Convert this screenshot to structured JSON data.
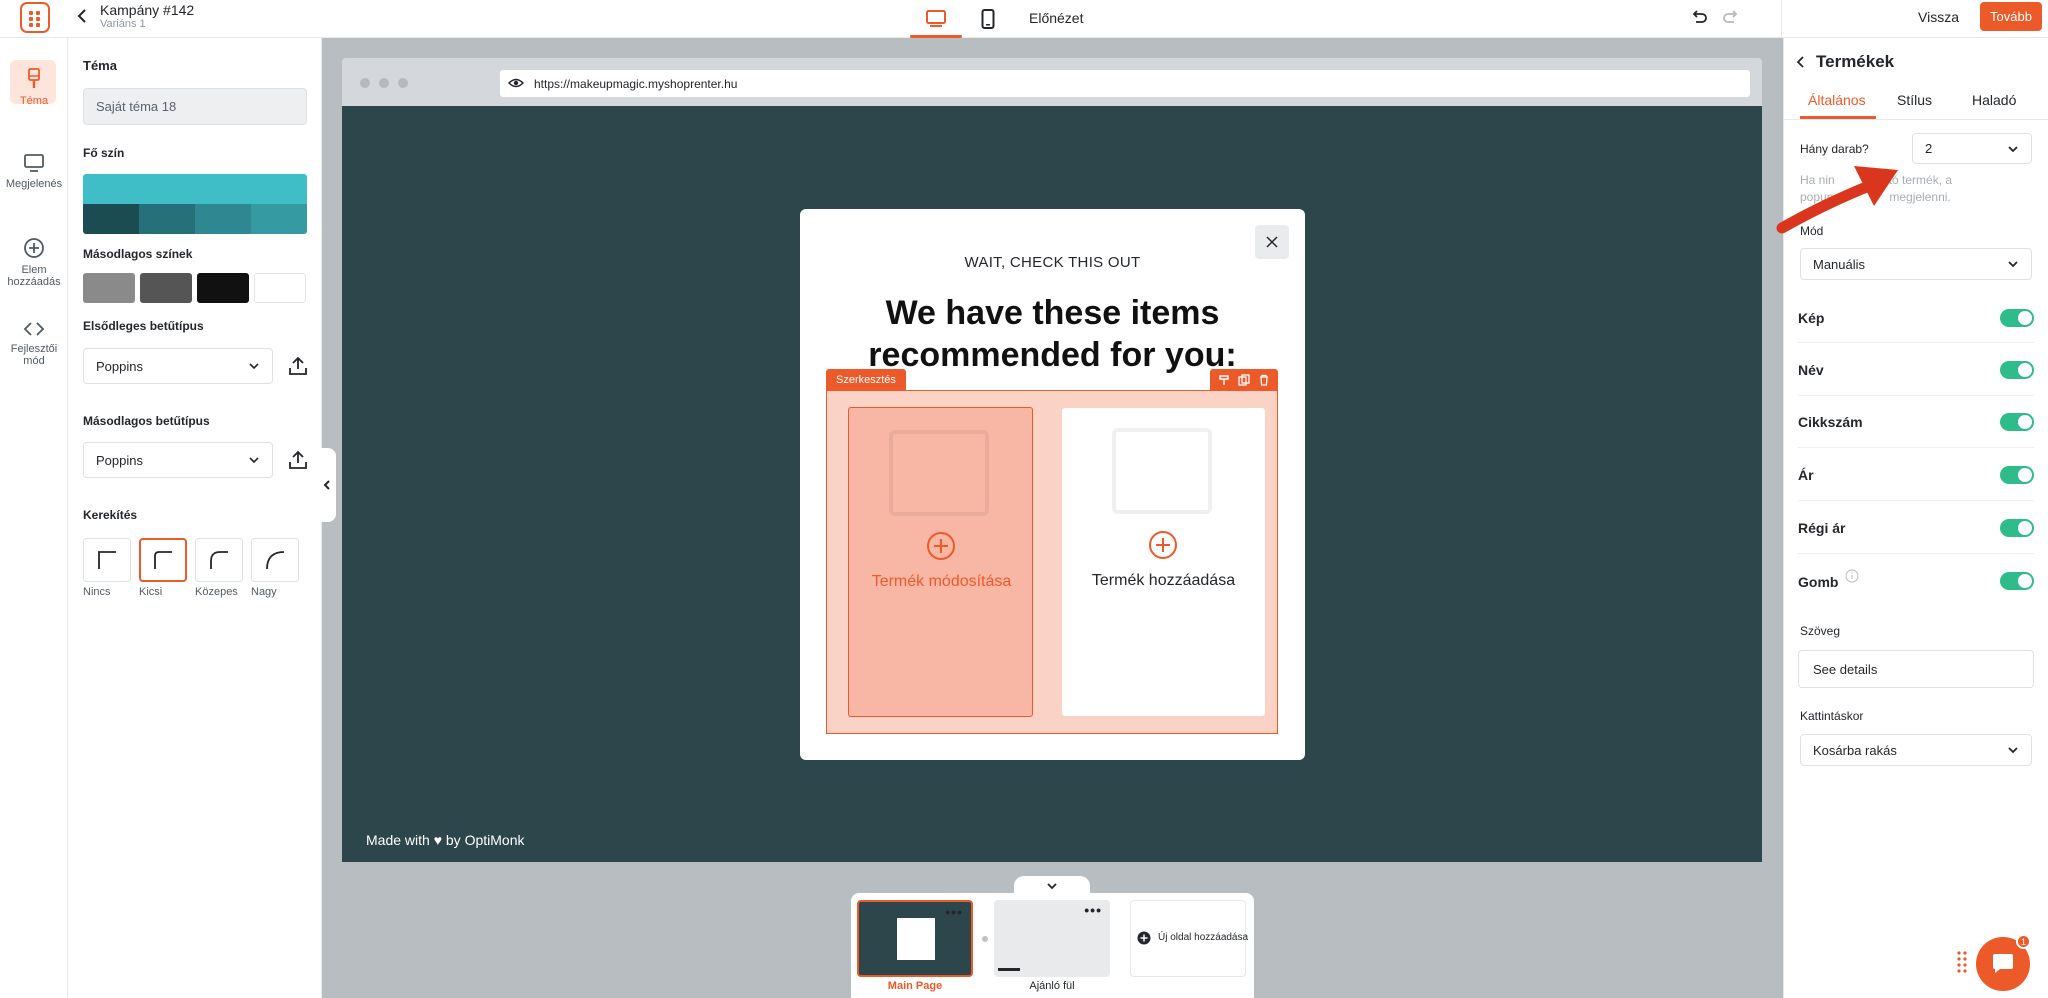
{
  "header": {
    "campaign_title": "Kampány #142",
    "variant": "Variáns 1",
    "preview_label": "Előnézet",
    "back_label": "Vissza",
    "next_label": "Tovább"
  },
  "rail": {
    "items": [
      {
        "label": "Téma",
        "icon": "brush-icon",
        "active": true
      },
      {
        "label": "Megjelenés",
        "icon": "monitor-icon",
        "active": false
      },
      {
        "label": "Elem hozzáadás",
        "icon": "plus-circle-icon",
        "active": false
      },
      {
        "label": "Fejlesztői mód",
        "icon": "code-icon",
        "active": false
      }
    ]
  },
  "theme_panel": {
    "title": "Téma",
    "theme_value": "Saját téma 18",
    "main_color_label": "Fő szín",
    "main_color": "#40bec8",
    "main_color_shades": [
      "#1b4c51",
      "#26707a",
      "#2f8891",
      "#369aa3"
    ],
    "secondary_colors_label": "Másodlagos színek",
    "secondary_colors": [
      "#8a8a8a",
      "#555555",
      "#111111",
      "#ffffff"
    ],
    "primary_font_label": "Elsődleges betűtípus",
    "primary_font_value": "Poppins",
    "secondary_font_label": "Másodlagos betűtípus",
    "secondary_font_value": "Poppins",
    "rounding_label": "Kerekítés",
    "rounding_options": [
      "Nincs",
      "Kicsi",
      "Közepes",
      "Nagy"
    ],
    "rounding_selected": "Kicsi"
  },
  "canvas": {
    "url": "https://makeupmagic.myshoprenter.hu",
    "made_with": "Made with ♥ by OptiMonk",
    "popup": {
      "eyebrow": "WAIT, CHECK THIS OUT",
      "heading": "We have these items recommended for you:",
      "edit_tag": "Szerkesztés",
      "card1_label": "Termék módosítása",
      "card2_label": "Termék hozzáadása"
    }
  },
  "pages": {
    "items": [
      "Main Page",
      "Ajánló fül"
    ],
    "active": "Main Page",
    "new_page_label": "Új oldal hozzáadása"
  },
  "right_panel": {
    "title": "Termékek",
    "tabs": [
      "Általános",
      "Stílus",
      "Haladó"
    ],
    "active_tab": "Általános",
    "count_label": "Hány darab?",
    "count_value": "2",
    "hint_visible": "Ha nin        lható termék, a popup            megjeleni.",
    "hint_line1": "Ha nin",
    "hint_line1b": "lható termék, a",
    "hint_line2": "popup",
    "hint_line2b": "megjelenni.",
    "mode_label": "Mód",
    "mode_value": "Manuális",
    "toggles": [
      {
        "label": "Kép",
        "on": true
      },
      {
        "label": "Név",
        "on": true
      },
      {
        "label": "Cikkszám",
        "on": true
      },
      {
        "label": "Ár",
        "on": true
      },
      {
        "label": "Régi ár",
        "on": true
      },
      {
        "label": "Gomb",
        "on": true
      }
    ],
    "text_label": "Szöveg",
    "text_value": "See details",
    "click_label": "Kattintáskor",
    "click_value": "Kosárba rakás"
  },
  "colors": {
    "accent": "#ed5a29",
    "toggle_on": "#2ebd8a",
    "site_bg": "#2d464b"
  },
  "chat": {
    "badge": "1"
  }
}
